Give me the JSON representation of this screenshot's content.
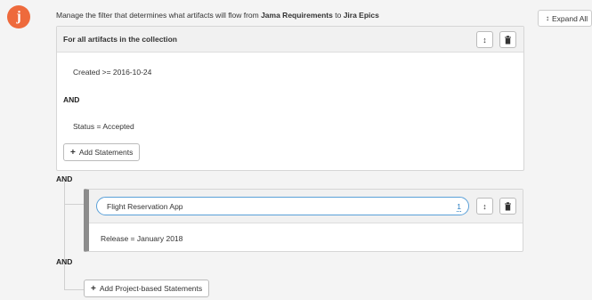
{
  "logo": {
    "letter": "j",
    "color": "#ee6a3c"
  },
  "header": {
    "prefix": "Manage the filter that determines what artifacts will flow from ",
    "source": "Jama Requirements",
    "middle": " to ",
    "target": "Jira Epics"
  },
  "expand_all": {
    "icon": "up-down-arrow-icon",
    "label": "Expand All"
  },
  "collection_panel": {
    "title": "For all artifacts in the collection",
    "statements": [
      "Created >= 2016-10-24",
      "Status = Accepted"
    ],
    "and_label": "AND",
    "add_label": "Add Statements"
  },
  "tree": {
    "and_label_1": "AND",
    "and_label_2": "AND"
  },
  "project_panel": {
    "project_name": "Flight Reservation App",
    "count": "1",
    "statement": "Release = January 2018"
  },
  "add_project_label": "Add Project-based Statements",
  "icons": {
    "reorder": "↕",
    "delete": "🗑",
    "plus": "+"
  }
}
